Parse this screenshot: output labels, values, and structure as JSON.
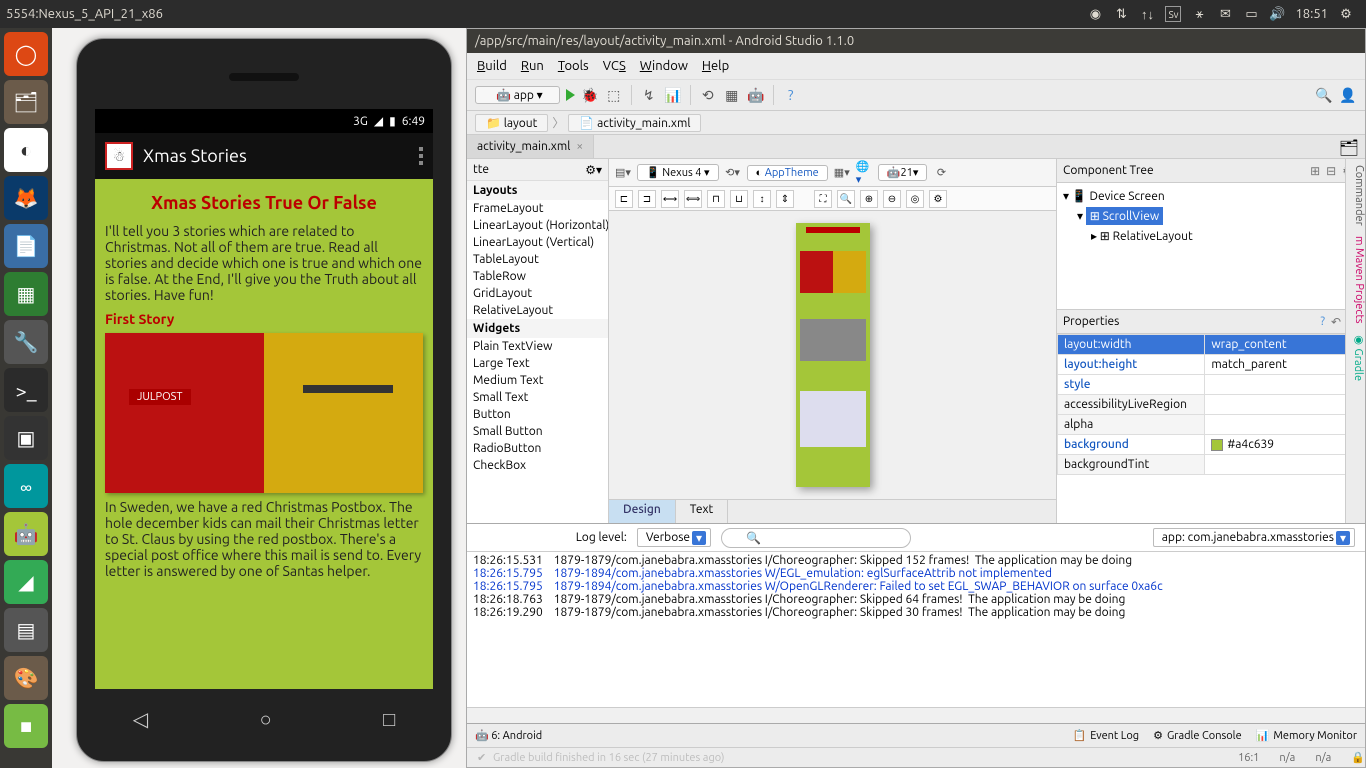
{
  "top_panel": {
    "title": "5554:Nexus_5_API_21_x86",
    "time": "18:51"
  },
  "launcher_items": [
    "ubuntu",
    "files",
    "chrome",
    "firefox",
    "writer",
    "calc",
    "settings",
    "terminal",
    "pin",
    "arduino",
    "android",
    "tools",
    "calculator",
    "gimp",
    "btn"
  ],
  "emulator": {
    "status_time": "6:49",
    "status_net": "3G",
    "app_name": "Xmas Stories",
    "h1": "Xmas Stories True Or False",
    "p1": "I'll tell you 3 stories which are related to Christmas. Not all of them are true. Read all stories and decide which one is true and which one is false. At the End, I'll give you the Truth about all stories. Have fun!",
    "h2": "First Story",
    "p2": "In Sweden, we have a red Christmas Postbox. The hole december kids can mail their Christmas letter to St. Claus by using the red postbox. There's a special post office where this mail is send to. Every letter is answered by one of Santas helper."
  },
  "studio": {
    "title": "/app/src/main/res/layout/activity_main.xml - Android Studio 1.1.0",
    "menu": [
      "Build",
      "Run",
      "Tools",
      "VCS",
      "Window",
      "Help"
    ],
    "config": "app",
    "breadcrumb": [
      "layout",
      "activity_main.xml"
    ],
    "tab": "activity_main.xml",
    "palette_title": "tte",
    "palette_sections": {
      "Layouts": [
        "FrameLayout",
        "LinearLayout (Horizontal)",
        "LinearLayout (Vertical)",
        "TableLayout",
        "TableRow",
        "GridLayout",
        "RelativeLayout"
      ],
      "Widgets": [
        "Plain TextView",
        "Large Text",
        "Medium Text",
        "Small Text",
        "Button",
        "Small Button",
        "RadioButton",
        "CheckBox"
      ]
    },
    "design_device": "Nexus 4",
    "design_theme": "AppTheme",
    "design_api": "21",
    "design_text_tabs": [
      "Design",
      "Text"
    ],
    "tree_title": "Component Tree",
    "tree": {
      "root": "Device Screen",
      "n1": "ScrollView",
      "n2": "RelativeLayout"
    },
    "props_title": "Properties",
    "props": [
      {
        "k": "layout:width",
        "v": "wrap_content",
        "hl": true
      },
      {
        "k": "layout:height",
        "v": "match_parent",
        "kb": true
      },
      {
        "k": "style",
        "v": "",
        "kb": true
      },
      {
        "k": "accessibilityLiveRegion",
        "v": ""
      },
      {
        "k": "alpha",
        "v": ""
      },
      {
        "k": "background",
        "v": "#a4c639",
        "kb": true,
        "swatch": true
      },
      {
        "k": "backgroundTint",
        "v": ""
      }
    ],
    "log_level_label": "Log level:",
    "log_level": "Verbose",
    "log_filter": "app: com.janebabra.xmasstories",
    "log_lines": [
      {
        "t": "18:26:15.531",
        "txt": "1879-1879/com.janebabra.xmasstories I/Choreographer: Skipped 152 frames!  The application may be doing",
        "c": "l"
      },
      {
        "t": "18:26:15.795",
        "txt": "1879-1894/com.janebabra.xmasstories W/EGL_emulation: eglSurfaceAttrib not implemented",
        "c": "w"
      },
      {
        "t": "18:26:15.795",
        "txt": "1879-1894/com.janebabra.xmasstories W/OpenGLRenderer: Failed to set EGL_SWAP_BEHAVIOR on surface 0xa6c",
        "c": "w"
      },
      {
        "t": "18:26:18.763",
        "txt": "1879-1879/com.janebabra.xmasstories I/Choreographer: Skipped 64 frames!  The application may be doing",
        "c": "l"
      },
      {
        "t": "18:26:19.290",
        "txt": "1879-1879/com.janebabra.xmasstories I/Choreographer: Skipped 30 frames!  The application may be doing",
        "c": "l"
      }
    ],
    "bottom_android": "6: Android",
    "bottom_tools": [
      "Event Log",
      "Gradle Console",
      "Memory Monitor"
    ],
    "status_pos": "16:1",
    "status_na": "n/a",
    "gradle_msg": "Gradle build finished in 16 sec (27 minutes ago)"
  }
}
